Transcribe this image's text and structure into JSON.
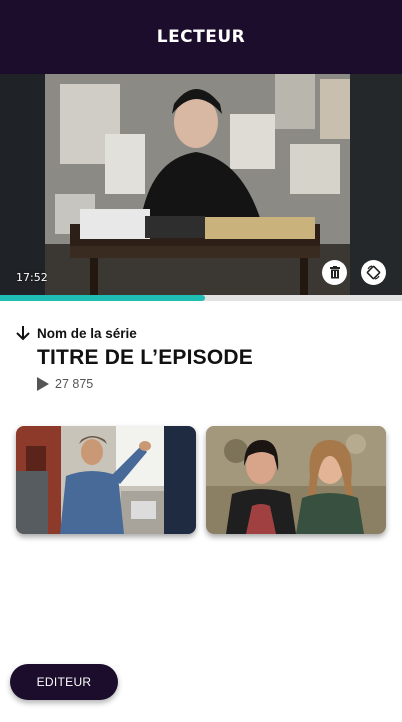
{
  "header": {
    "title": "LECTEUR"
  },
  "player": {
    "timestamp": "17:52",
    "progress": 0.51,
    "delete_icon": "trash-icon",
    "rotate_icon": "screen-rotation-icon"
  },
  "episode": {
    "series_name": "Nom de la série",
    "title": "TITRE DE L’EPISODE",
    "views": "27 875"
  },
  "related": [
    {
      "name": "man-in-denim-shirt-street"
    },
    {
      "name": "two-women-outdoors"
    }
  ],
  "footer": {
    "editor_label": "EDITEUR"
  },
  "colors": {
    "header": "#1b0d2b",
    "accent": "#1fbdb3"
  }
}
